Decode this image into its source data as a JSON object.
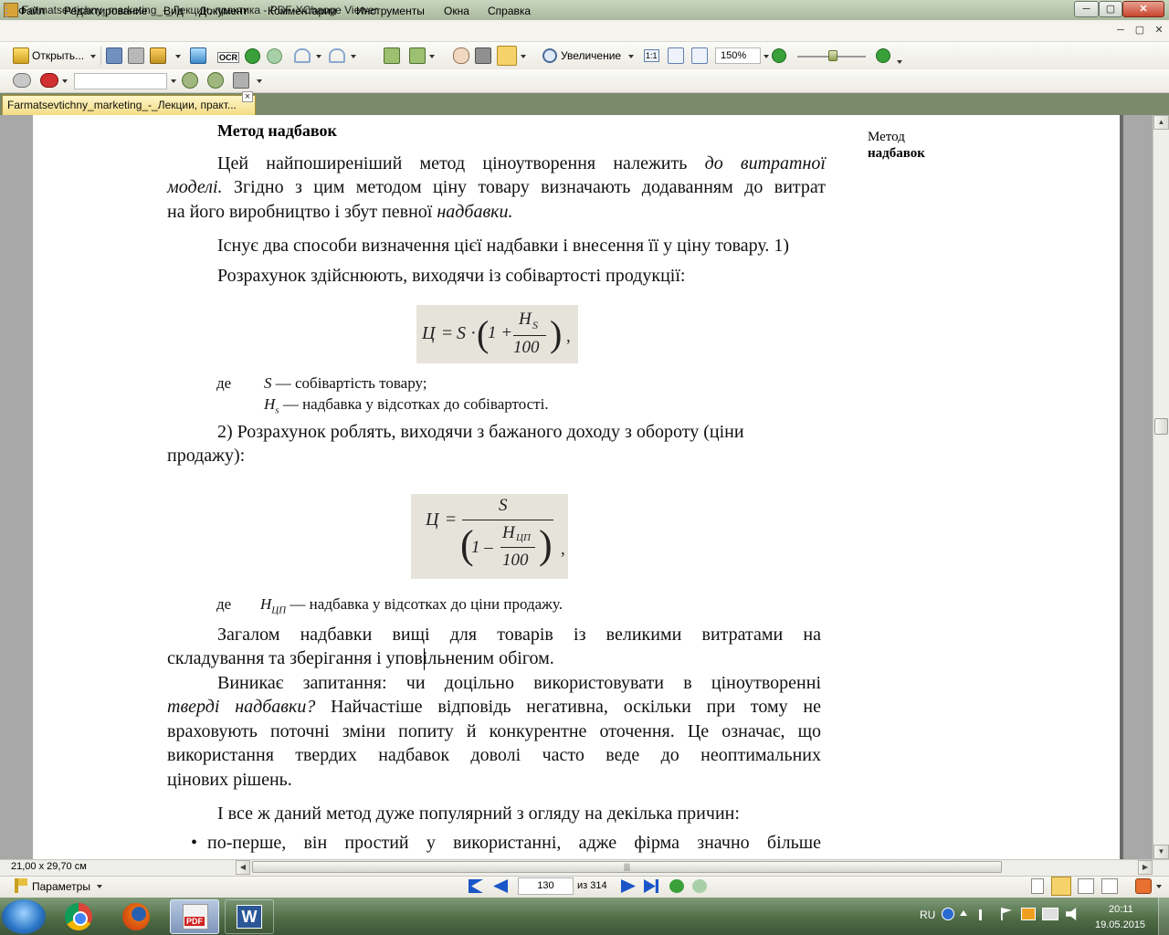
{
  "window": {
    "title": "Farmatsevtichny_marketing_-_Лекции, практика - PDF-XChange Viewer",
    "btn_min": "─",
    "btn_max": "▢",
    "btn_close": "✕"
  },
  "menu": {
    "items": [
      "Файл",
      "Редактирование",
      "Вид",
      "Документ",
      "Комментарии",
      "Инструменты",
      "Окна",
      "Справка"
    ]
  },
  "toolbar": {
    "open_label": "Открыть...",
    "ocr_label": "OCR",
    "zoom_label": "Увеличение",
    "zoom_value": "150%",
    "actual_size_label": "1:1"
  },
  "tab": {
    "label": "Farmatsevtichny_marketing_-_Лекции, практ...",
    "close": "×"
  },
  "document": {
    "heading": "Метод надбавок",
    "margin_note_line1": "Метод",
    "margin_note_line2": "надбавок",
    "p1_l1_pre": "Цей найпоширеніший метод ціноутворення належить ",
    "p1_l1_em": "до витратної",
    "p1_l2_em": "моделі.",
    "p1_l2_post": " Згідно з цим методом ціну товару визначають додаванням до витрат",
    "p1_l3_pre": "на його виробництво і збут певної ",
    "p1_l3_em": "надбавки.",
    "p2_l1": "Існує два способи визначення цієї надбавки і внесення її у ціну товару. 1)",
    "p2_l2": "Розрахунок здійснюють, виходячи із собівартості продукції:",
    "formula1": {
      "lhs": "Ц",
      "eq": "=",
      "s": "S",
      "dot": "·",
      "one_plus": "1 +",
      "num_main": "Н",
      "num_sub": "S",
      "den": "100",
      "trail": ","
    },
    "where1": "де",
    "def1_sym": "S",
    "def1_text": " — собівартість товару;",
    "def2_sym": "H",
    "def2_sub": "s",
    "def2_text": " — надбавка у відсотках до собівартості.",
    "p3_l1": "2) Розрахунок роблять, виходячи з бажаного доходу з обороту (ціни",
    "p3_l2": "продажу):",
    "formula2": {
      "lhs": "Ц",
      "eq": "=",
      "num": "S",
      "one_minus": "1 –",
      "inner_main": "Н",
      "inner_sub": "ЦП",
      "inner_den": "100",
      "trail": ","
    },
    "where2": "де",
    "def3_sym": "Н",
    "def3_sub": "ЦП",
    "def3_text": " — надбавка у відсотках до ціни продажу.",
    "p4_l1": "Загалом надбавки вищі для товарів із великими витратами на",
    "p4_l2": "складування та зберігання і уповільненим обігом.",
    "p5_l1": "Виникає запитання: чи доцільно використовувати в ціноутворенні",
    "p5_l2_em": "тверді надбавки?",
    "p5_l2_post": " Найчастіше відповідь негативна, оскільки при тому не",
    "p5_l3": "враховують поточні зміни попиту й конкурентне оточення. Це означає, що",
    "p5_l4": "використання твердих надбавок доволі часто веде до неоптимальних",
    "p5_l5": "цінових рішень.",
    "p6_l1": "І все ж даний метод дуже популярний з огляду на декілька причин:",
    "bullet": "•",
    "p7_l1": "по-перше, він простий у використанні, адже фірма значно більше"
  },
  "scroll": {
    "page_size": "21,00 x 29,70 см",
    "grip": "|||"
  },
  "status": {
    "params_label": "Параметры",
    "current_page": "130",
    "total_pages": "из 314"
  },
  "taskbar": {
    "lang": "RU",
    "time": "20:11",
    "date": "19.05.2015",
    "pdf_label": "PDF",
    "word_label": "W"
  },
  "colors": {
    "tab_bg": "#f3dc86",
    "nav_blue": "#1a56c8",
    "green_btn": "#3aa03a"
  }
}
